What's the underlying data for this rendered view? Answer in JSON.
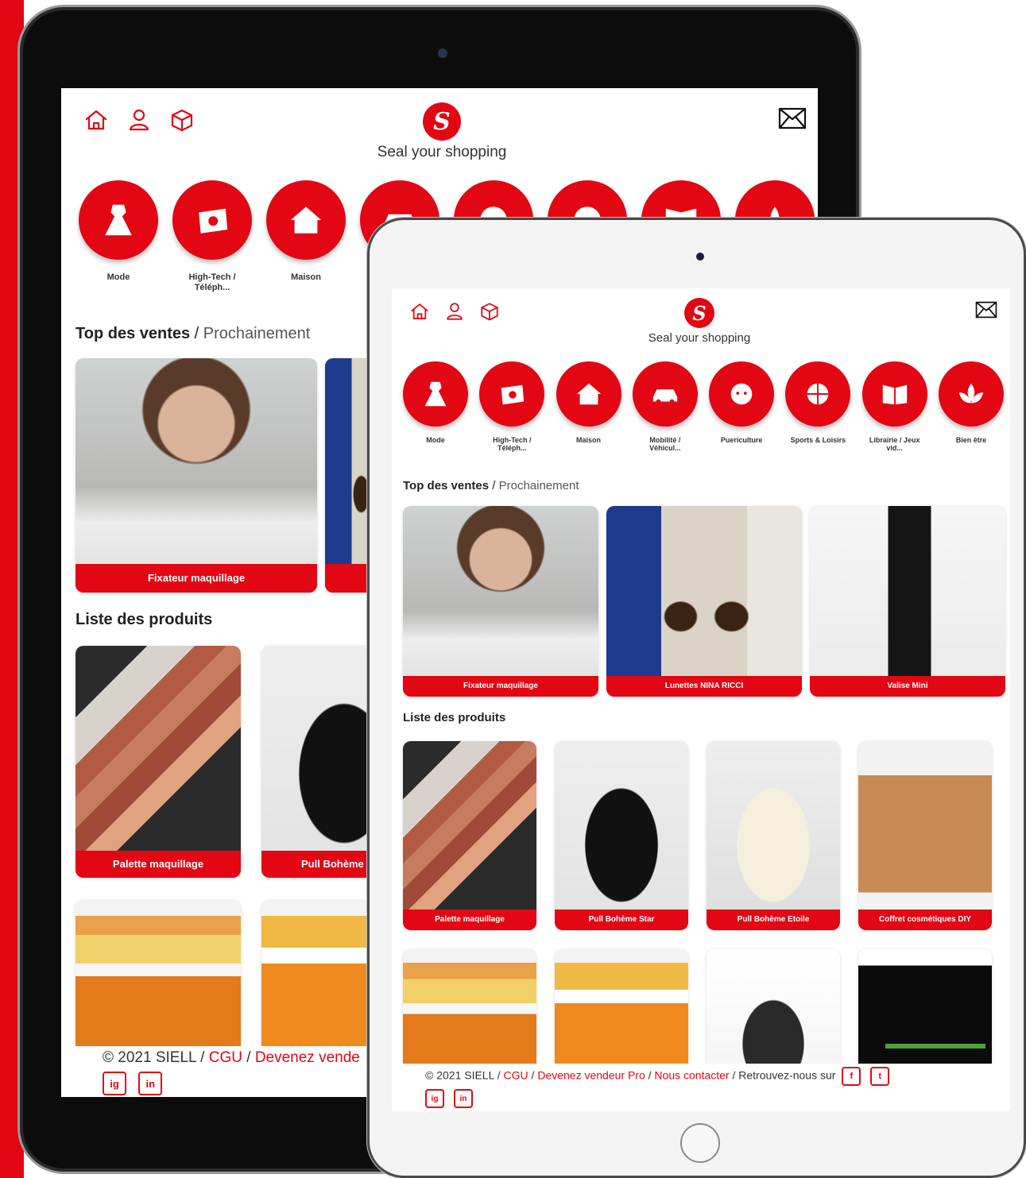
{
  "app": {
    "tagline": "Seal your shopping",
    "logo_letter": "S",
    "brand_color": "#e30613"
  },
  "header_icons": [
    "home-icon",
    "user-icon",
    "box-icon"
  ],
  "mail_icon": "mail-icon",
  "categories": [
    {
      "label": "Mode",
      "icon": "dress-icon"
    },
    {
      "label": "High-Tech / Téléph...",
      "icon": "photo-icon"
    },
    {
      "label": "Maison",
      "icon": "house-icon"
    },
    {
      "label": "Mobilité / Véhicul...",
      "icon": "car-icon"
    },
    {
      "label": "Puericulture",
      "icon": "baby-icon"
    },
    {
      "label": "Sports & Loisirs",
      "icon": "ball-icon"
    },
    {
      "label": "Librairie / Jeux vid...",
      "icon": "book-icon"
    },
    {
      "label": "Bien être",
      "icon": "lotus-icon"
    }
  ],
  "top_section": {
    "title": "Top des ventes",
    "separator": " / ",
    "subtitle": "Prochainement"
  },
  "top_products": [
    {
      "name": "Fixateur maquillage"
    },
    {
      "name": "Lunettes NINA RICCI"
    },
    {
      "name": "Valise Mini"
    }
  ],
  "list_section": {
    "title": "Liste des produits"
  },
  "products": [
    {
      "name": "Palette maquillage"
    },
    {
      "name": "Pull Bohème Star"
    },
    {
      "name": "Pull Bohème Etoile"
    },
    {
      "name": "Coffret cosmétiques DIY"
    }
  ],
  "black_tablet": {
    "partial_product_2": "Pull Bohème S",
    "footer_partial_link": "Devenez vende"
  },
  "footer": {
    "copyright": "© 2021 SIELL",
    "sep": " / ",
    "cgu": "CGU",
    "seller": "Devenez vendeur Pro",
    "contact": "Nous contacter",
    "follow": "Retrouvez-nous sur",
    "social": {
      "facebook": "f",
      "twitter": "t",
      "instagram": "ig",
      "linkedin": "in"
    }
  }
}
